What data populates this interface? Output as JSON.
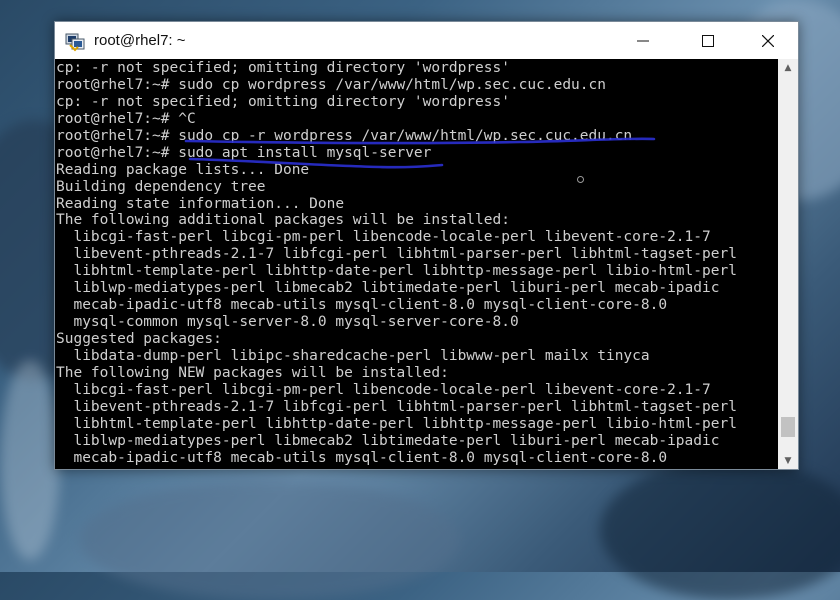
{
  "window": {
    "title": "root@rhel7: ~",
    "app_icon": "putty-icon"
  },
  "terminal": {
    "lines": [
      "cp: -r not specified; omitting directory 'wordpress'",
      "root@rhel7:~# sudo cp wordpress /var/www/html/wp.sec.cuc.edu.cn",
      "cp: -r not specified; omitting directory 'wordpress'",
      "root@rhel7:~# ^C",
      "root@rhel7:~# sudo cp -r wordpress /var/www/html/wp.sec.cuc.edu.cn",
      "root@rhel7:~# sudo apt install mysql-server",
      "Reading package lists... Done",
      "Building dependency tree",
      "Reading state information... Done",
      "The following additional packages will be installed:",
      "  libcgi-fast-perl libcgi-pm-perl libencode-locale-perl libevent-core-2.1-7",
      "  libevent-pthreads-2.1-7 libfcgi-perl libhtml-parser-perl libhtml-tagset-perl",
      "  libhtml-template-perl libhttp-date-perl libhttp-message-perl libio-html-perl",
      "  liblwp-mediatypes-perl libmecab2 libtimedate-perl liburi-perl mecab-ipadic",
      "  mecab-ipadic-utf8 mecab-utils mysql-client-8.0 mysql-client-core-8.0",
      "  mysql-common mysql-server-8.0 mysql-server-core-8.0",
      "Suggested packages:",
      "  libdata-dump-perl libipc-sharedcache-perl libwww-perl mailx tinyca",
      "The following NEW packages will be installed:",
      "  libcgi-fast-perl libcgi-pm-perl libencode-locale-perl libevent-core-2.1-7",
      "  libevent-pthreads-2.1-7 libfcgi-perl libhtml-parser-perl libhtml-tagset-perl",
      "  libhtml-template-perl libhttp-date-perl libhttp-message-perl libio-html-perl",
      "  liblwp-mediatypes-perl libmecab2 libtimedate-perl liburi-perl mecab-ipadic",
      "  mecab-ipadic-utf8 mecab-utils mysql-client-8.0 mysql-client-core-8.0"
    ]
  },
  "colors": {
    "terminal_bg": "#000000",
    "terminal_fg": "#cfcfcf",
    "annotation_ink": "#2a2fd0"
  }
}
